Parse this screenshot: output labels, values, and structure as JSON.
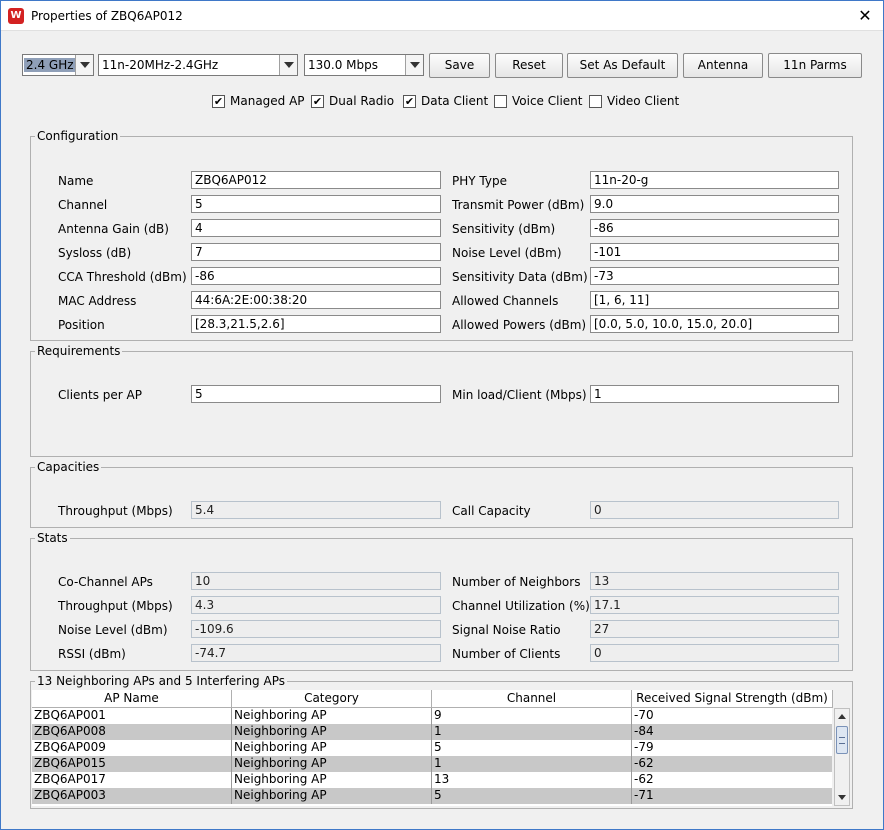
{
  "window": {
    "title": "Properties of ZBQ6AP012",
    "app_icon_glyph": "W",
    "close_glyph": "✕"
  },
  "toolbar": {
    "band": "2.4 GHz",
    "mode": "11n-20MHz-2.4GHz",
    "rate": "130.0 Mbps",
    "save_label": "Save",
    "reset_label": "Reset",
    "set_default_label": "Set As Default",
    "antenna_label": "Antenna",
    "parms_label": "11n Parms"
  },
  "options": [
    {
      "label": "Managed AP",
      "checked": true
    },
    {
      "label": "Dual Radio",
      "checked": true
    },
    {
      "label": "Data Client",
      "checked": true
    },
    {
      "label": "Voice Client",
      "checked": false
    },
    {
      "label": "Video Client",
      "checked": false
    }
  ],
  "configuration": {
    "title": "Configuration",
    "left": [
      {
        "label": "Name",
        "value": "ZBQ6AP012"
      },
      {
        "label": "Channel",
        "value": "5"
      },
      {
        "label": "Antenna Gain (dB)",
        "value": "4"
      },
      {
        "label": "Sysloss (dB)",
        "value": "7"
      },
      {
        "label": "CCA Threshold (dBm)",
        "value": "-86"
      },
      {
        "label": "MAC Address",
        "value": "44:6A:2E:00:38:20"
      },
      {
        "label": "Position",
        "value": "[28.3,21.5,2.6]"
      }
    ],
    "right": [
      {
        "label": "PHY Type",
        "value": "11n-20-g"
      },
      {
        "label": "Transmit Power (dBm)",
        "value": "9.0"
      },
      {
        "label": "Sensitivity (dBm)",
        "value": "-86"
      },
      {
        "label": "Noise Level (dBm)",
        "value": "-101"
      },
      {
        "label": "Sensitivity Data (dBm)",
        "value": "-73"
      },
      {
        "label": "Allowed Channels",
        "value": "[1, 6, 11]"
      },
      {
        "label": "Allowed Powers (dBm)",
        "value": "[0.0, 5.0, 10.0, 15.0, 20.0]"
      }
    ]
  },
  "requirements": {
    "title": "Requirements",
    "clients_label": "Clients per AP",
    "clients_value": "5",
    "minload_label": "Min load/Client (Mbps)",
    "minload_value": "1"
  },
  "capacities": {
    "title": "Capacities",
    "throughput_label": "Throughput (Mbps)",
    "throughput_value": "5.4",
    "call_label": "Call Capacity",
    "call_value": "0"
  },
  "stats": {
    "title": "Stats",
    "left": [
      {
        "label": "Co-Channel APs",
        "value": "10"
      },
      {
        "label": "Throughput (Mbps)",
        "value": "4.3"
      },
      {
        "label": "Noise Level (dBm)",
        "value": "-109.6"
      },
      {
        "label": "RSSI (dBm)",
        "value": "-74.7"
      }
    ],
    "right": [
      {
        "label": "Number of Neighbors",
        "value": "13"
      },
      {
        "label": "Channel Utilization (%)",
        "value": "17.1"
      },
      {
        "label": "Signal Noise Ratio",
        "value": "27"
      },
      {
        "label": "Number of Clients",
        "value": "0"
      }
    ]
  },
  "neighbors": {
    "title": "13 Neighboring APs and 5 Interfering APs",
    "columns": [
      "AP Name",
      "Category",
      "Channel",
      "Received Signal Strength (dBm)"
    ],
    "rows": [
      [
        "ZBQ6AP001",
        "Neighboring AP",
        "9",
        "-70"
      ],
      [
        "ZBQ6AP008",
        "Neighboring AP",
        "1",
        "-84"
      ],
      [
        "ZBQ6AP009",
        "Neighboring AP",
        "5",
        "-79"
      ],
      [
        "ZBQ6AP015",
        "Neighboring AP",
        "1",
        "-62"
      ],
      [
        "ZBQ6AP017",
        "Neighboring AP",
        "13",
        "-62"
      ],
      [
        "ZBQ6AP003",
        "Neighboring AP",
        "5",
        "-71"
      ]
    ]
  }
}
